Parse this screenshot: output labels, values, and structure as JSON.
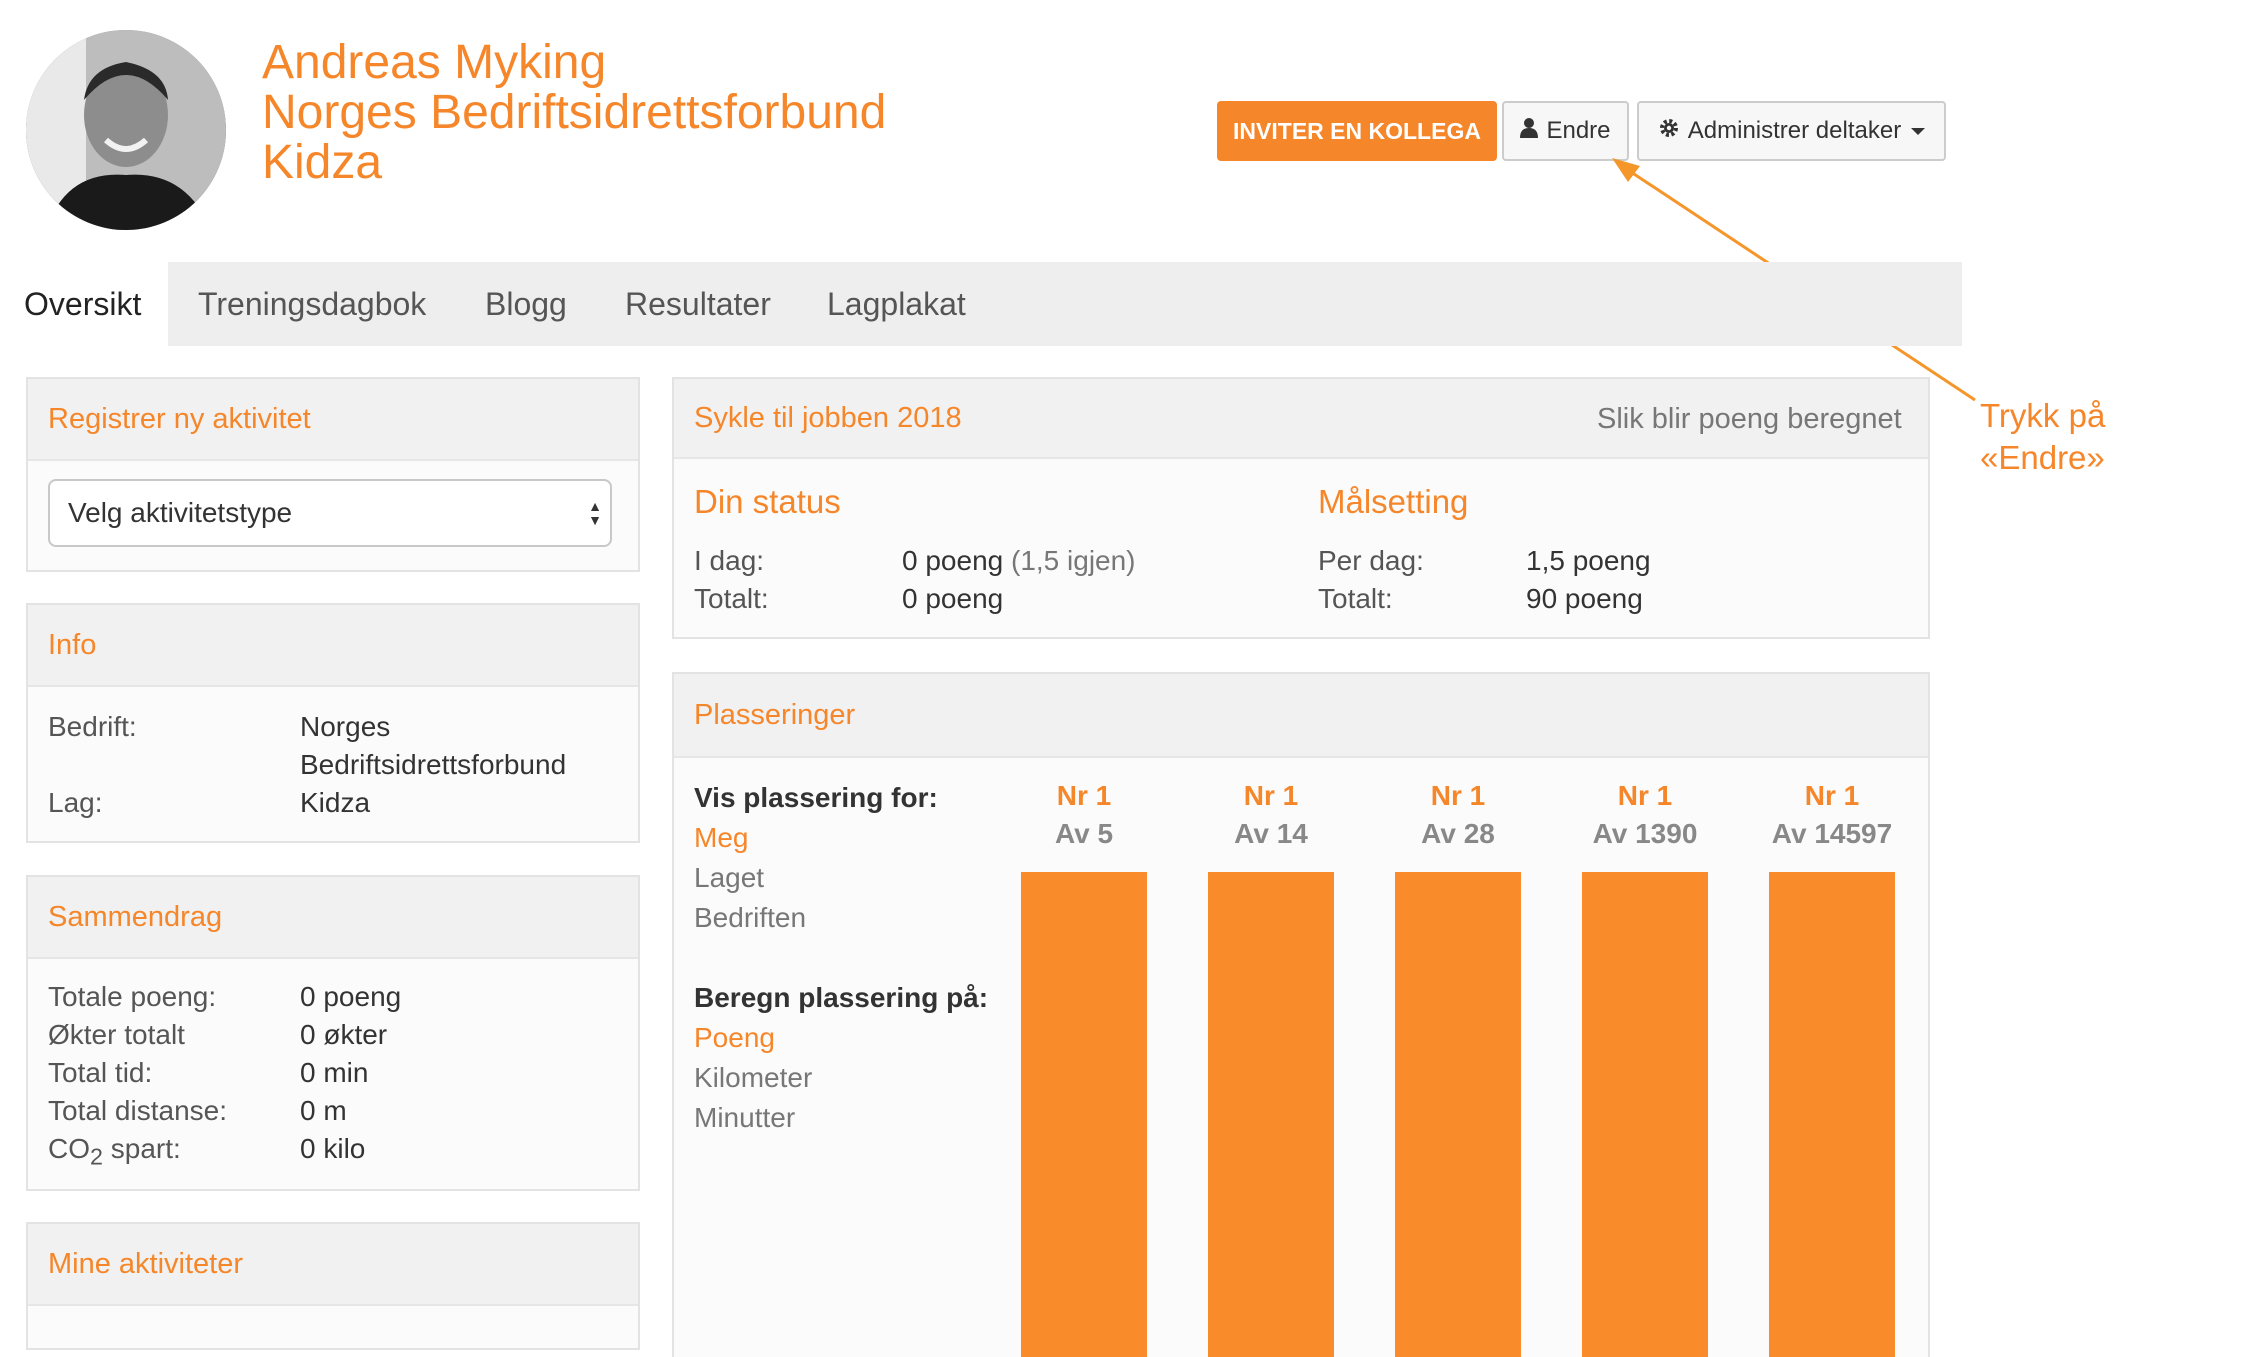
{
  "header": {
    "name": "Andreas Myking",
    "company": "Norges Bedriftsidrettsforbund",
    "team": "Kidza",
    "invite_button": "INVITER EN KOLLEGA",
    "edit_button": "Endre",
    "admin_button": "Administrer deltaker"
  },
  "annotation": {
    "line1": "Trykk på",
    "line2": "«Endre»"
  },
  "tabs": [
    "Oversikt",
    "Treningsdagbok",
    "Blogg",
    "Resultater",
    "Lagplakat"
  ],
  "register": {
    "title": "Registrer ny aktivitet",
    "select_value": "Velg aktivitetstype"
  },
  "info": {
    "title": "Info",
    "company_label": "Bedrift:",
    "company_line1": "Norges",
    "company_line2": "Bedriftsidrettsforbund",
    "team_label": "Lag:",
    "team_value": "Kidza"
  },
  "summary": {
    "title": "Sammendrag",
    "rows": [
      {
        "label": "Totale poeng:",
        "value": "0 poeng"
      },
      {
        "label": "Økter totalt",
        "value": "0 økter"
      },
      {
        "label": "Total tid:",
        "value": "0 min"
      },
      {
        "label": "Total distanse:",
        "value": "0 m"
      },
      {
        "label": "CO",
        "sub": "2",
        "label_after": " spart:",
        "value": "0 kilo"
      }
    ]
  },
  "activities": {
    "title": "Mine aktiviteter"
  },
  "campaign": {
    "title": "Sykle til jobben 2018",
    "points_link": "Slik blir poeng beregnet",
    "status_title": "Din status",
    "today_label": "I dag:",
    "today_value": "0 poeng",
    "today_remaining": "(1,5 igjen)",
    "total_label": "Totalt:",
    "total_value": "0 poeng",
    "goal_title": "Målsetting",
    "per_day_label": "Per dag:",
    "per_day_value": "1,5 poeng",
    "goal_total_label": "Totalt:",
    "goal_total_value": "90 poeng"
  },
  "rankings": {
    "title": "Plasseringer",
    "show_for_label": "Vis plassering for:",
    "show_for_options": [
      "Meg",
      "Laget",
      "Bedriften"
    ],
    "show_for_selected": 0,
    "calc_label": "Beregn plassering på:",
    "calc_options": [
      "Poeng",
      "Kilometer",
      "Minutter"
    ],
    "calc_selected": 0,
    "columns": [
      {
        "rank": "Nr 1",
        "of": "Av 5"
      },
      {
        "rank": "Nr 1",
        "of": "Av 14"
      },
      {
        "rank": "Nr 1",
        "of": "Av 28"
      },
      {
        "rank": "Nr 1",
        "of": "Av 1390"
      },
      {
        "rank": "Nr 1",
        "of": "Av 14597"
      }
    ]
  },
  "colors": {
    "accent": "#f5862a",
    "bar": "#f98b2b"
  }
}
